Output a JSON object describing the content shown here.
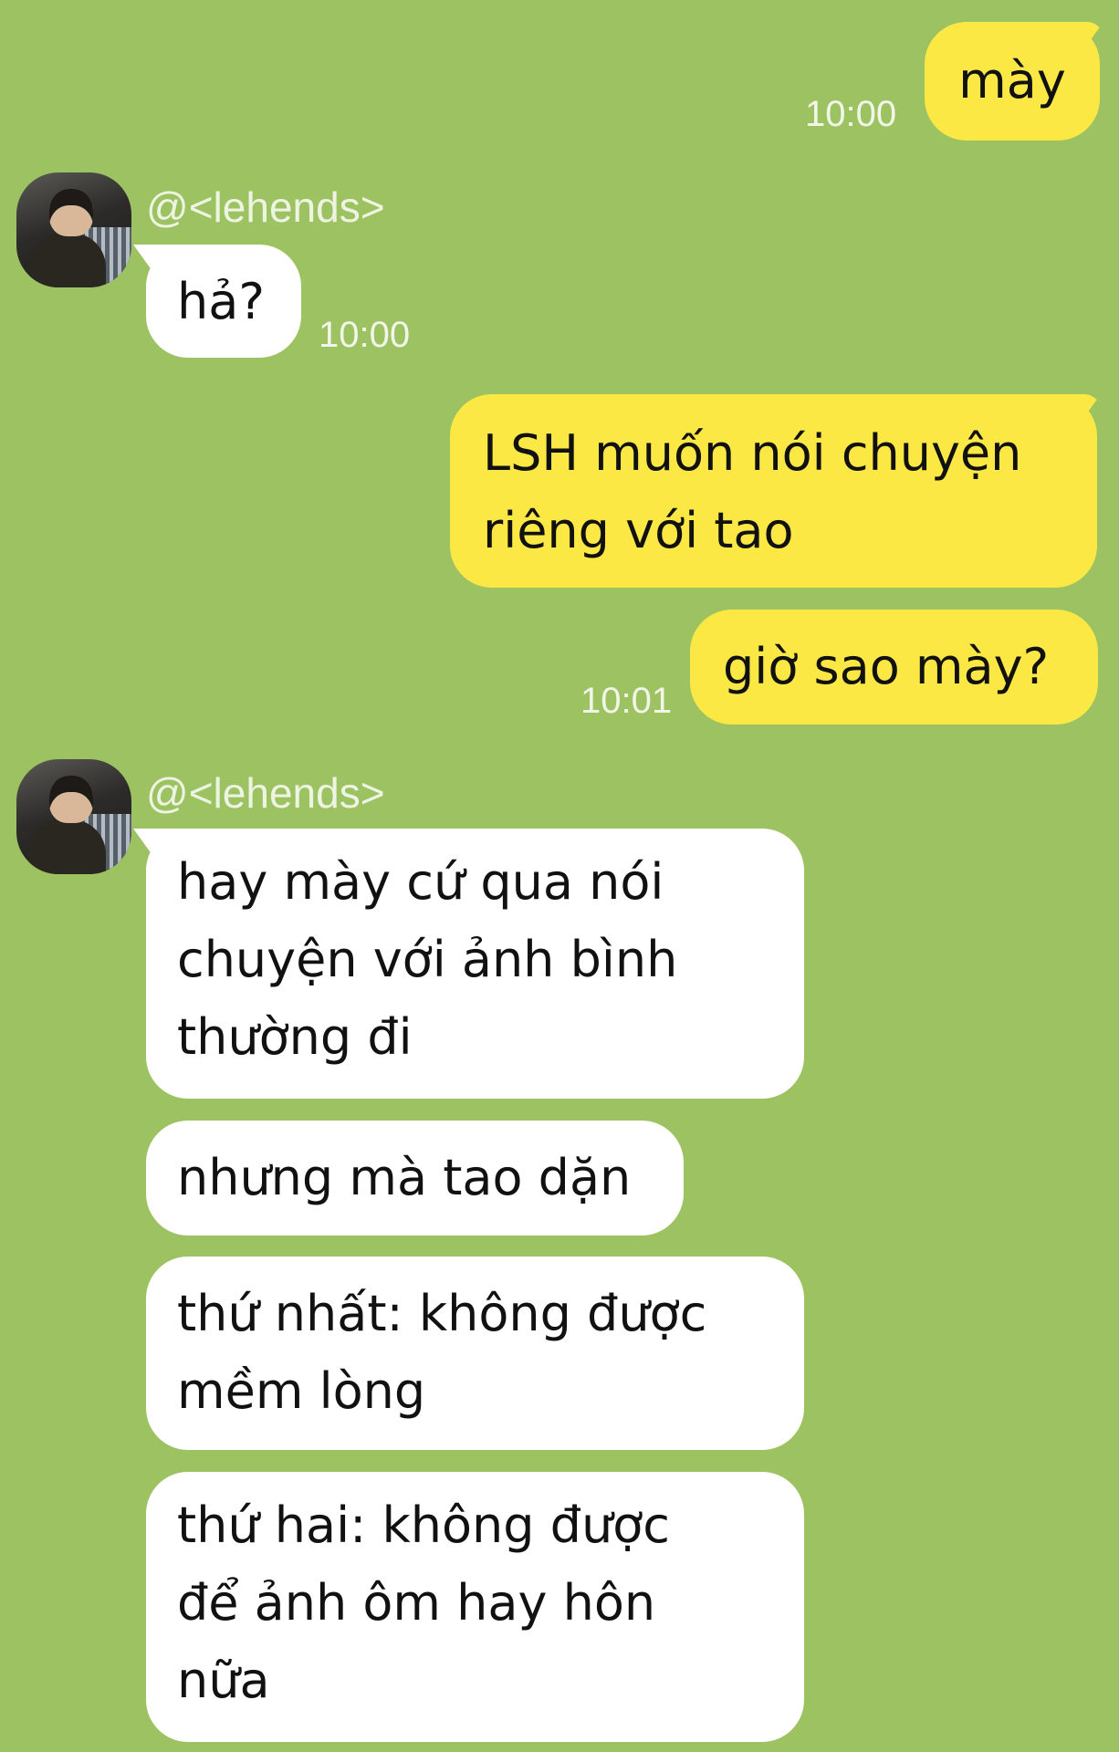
{
  "colors": {
    "background": "#9dc262",
    "my_bubble": "#fbe845",
    "their_bubble": "#ffffff"
  },
  "contact": {
    "name": "@<lehends>",
    "avatar_icon": "profile-photo"
  },
  "messages": [
    {
      "from": "me",
      "text": "mày",
      "time": "10:00"
    },
    {
      "from": "them",
      "text": "hả?",
      "time": "10:00"
    },
    {
      "from": "me",
      "lines": [
        "LSH muốn nói chuyện",
        "riêng với tao"
      ]
    },
    {
      "from": "me",
      "text": "giờ sao mày?",
      "time": "10:01"
    },
    {
      "from": "them",
      "lines": [
        "hay mày cứ qua nói",
        "chuyện với ảnh bình",
        "thường đi"
      ]
    },
    {
      "from": "them",
      "text": "nhưng mà tao dặn"
    },
    {
      "from": "them",
      "lines": [
        "thứ nhất: không được",
        "mềm lòng"
      ]
    },
    {
      "from": "them",
      "lines": [
        "thứ hai: không được",
        "để ảnh ôm hay hôn",
        "nữa"
      ]
    }
  ]
}
